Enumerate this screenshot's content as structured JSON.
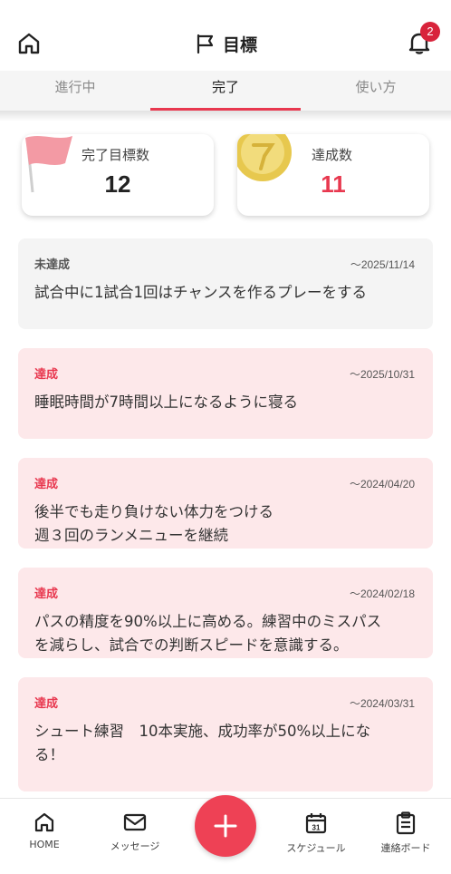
{
  "header": {
    "title": "目標",
    "notification_count": "2"
  },
  "tabs": [
    {
      "label": "進行中",
      "active": false
    },
    {
      "label": "完了",
      "active": true
    },
    {
      "label": "使い方",
      "active": false
    }
  ],
  "summary": {
    "completed_label": "完了目標数",
    "completed_value": "12",
    "achieved_label": "達成数",
    "achieved_value": "11"
  },
  "goals": [
    {
      "status": "未達成",
      "deadline": "〜2025/11/14",
      "text": "試合中に1試合1回はチャンスを作るプレーをする",
      "achieved": false
    },
    {
      "status": "達成",
      "deadline": "〜2025/10/31",
      "text": "睡眠時間が7時間以上になるように寝る",
      "achieved": true
    },
    {
      "status": "達成",
      "deadline": "〜2024/04/20",
      "text_lines": [
        "後半でも走り負けない体力をつける",
        "週３回のランメニューを継続"
      ],
      "achieved": true
    },
    {
      "status": "達成",
      "deadline": "〜2024/02/18",
      "text_lines": [
        "パスの精度を90%以上に高める。練習中のミスパス",
        "を減らし、試合での判断スピードを意識する。"
      ],
      "achieved": true
    },
    {
      "status": "達成",
      "deadline": "〜2024/03/31",
      "text_lines": [
        "シュート練習　10本実施、成功率が50%以上にな",
        "る！"
      ],
      "achieved": true
    }
  ],
  "bottom_nav": {
    "home": "HOME",
    "message": "メッセージ",
    "schedule": "スケジュール",
    "schedule_day": "31",
    "board": "連絡ボード"
  },
  "colors": {
    "accent": "#e8384f",
    "achieved_bg": "#fde8ea",
    "pending_bg": "#f4f4f4",
    "fab": "#ee4155"
  }
}
